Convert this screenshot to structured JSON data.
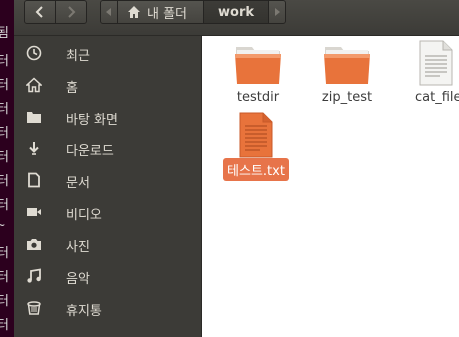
{
  "colors": {
    "toolbar": "#3c3b37",
    "sidebar": "#3c3b37",
    "sidebar_text": "#dfdbd2",
    "folder_orange": "#e8733b",
    "selection": "#e7744a",
    "terminal_bg": "#2c001e"
  },
  "toolbar": {
    "back_icon": "chevron-left-icon",
    "forward_icon": "chevron-right-icon",
    "breadcrumb": [
      {
        "label": "내 폴더",
        "icon": "home-icon"
      },
      {
        "label": "work"
      }
    ]
  },
  "sidebar": {
    "items": [
      {
        "label": "최근",
        "icon": "clock-icon"
      },
      {
        "label": "홈",
        "icon": "home-icon"
      },
      {
        "label": "바탕 화면",
        "icon": "folder-icon"
      },
      {
        "label": "다운로드",
        "icon": "download-icon"
      },
      {
        "label": "문서",
        "icon": "document-icon"
      },
      {
        "label": "비디오",
        "icon": "video-icon"
      },
      {
        "label": "사진",
        "icon": "camera-icon"
      },
      {
        "label": "음악",
        "icon": "music-icon"
      },
      {
        "label": "휴지통",
        "icon": "trash-icon"
      }
    ]
  },
  "files": [
    {
      "name": "testdir",
      "type": "folder",
      "selected": false
    },
    {
      "name": "zip_test",
      "type": "folder",
      "selected": false
    },
    {
      "name": "cat_file",
      "type": "text-file",
      "selected": false
    },
    {
      "name": "테스트.txt",
      "type": "text-file",
      "selected": true
    }
  ]
}
